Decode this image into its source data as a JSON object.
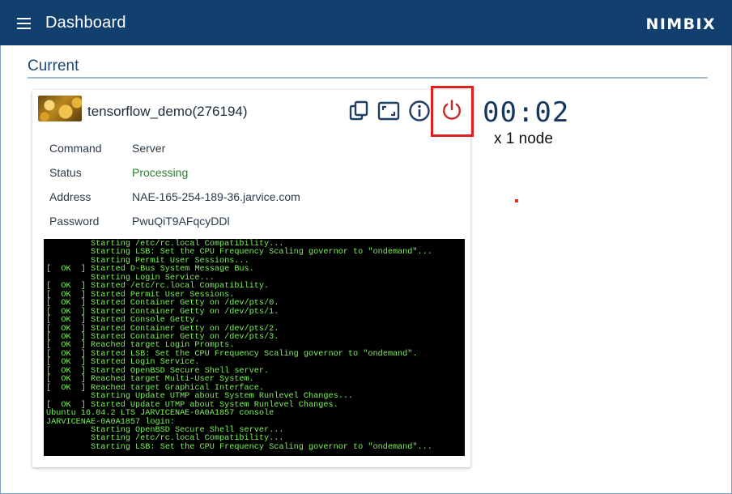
{
  "header": {
    "menu_icon": "hamburger-menu-icon",
    "title": "Dashboard",
    "logo_text": "NIMBIX",
    "background_color": "#113f6e"
  },
  "section": {
    "title": "Current"
  },
  "job": {
    "name": "tensorflow_demo(276194)",
    "thumbnail_icon": "app-thumbnail-image",
    "actions": [
      {
        "name": "copy-icon"
      },
      {
        "name": "fullscreen-icon"
      },
      {
        "name": "info-icon"
      },
      {
        "name": "power-icon",
        "color": "#c62828"
      }
    ],
    "details": [
      {
        "label": "Command",
        "value": "Server"
      },
      {
        "label": "Status",
        "value": "Processing"
      },
      {
        "label": "Address",
        "value": "NAE-165-254-189-36.jarvice.com"
      },
      {
        "label": "Password",
        "value": "PwuQiT9AFqcyDDl"
      }
    ],
    "console_lines": [
      "         Starting /etc/rc.local Compatibility...",
      "         Starting LSB: Set the CPU Frequency Scaling governor to \"ondemand\"...",
      "         Starting Permit User Sessions...",
      "[  OK  ] Started D-Bus System Message Bus.",
      "         Starting Login Service...",
      "[  OK  ] Started /etc/rc.local Compatibility.",
      "[  OK  ] Started Permit User Sessions.",
      "[  OK  ] Started Container Getty on /dev/pts/0.",
      "[  OK  ] Started Container Getty on /dev/pts/1.",
      "[  OK  ] Started Console Getty.",
      "[  OK  ] Started Container Getty on /dev/pts/2.",
      "[  OK  ] Started Container Getty on /dev/pts/3.",
      "[  OK  ] Reached target Login Prompts.",
      "[  OK  ] Started LSB: Set the CPU Frequency Scaling governor to \"ondemand\".",
      "[  OK  ] Started Login Service.",
      "[  OK  ] Started OpenBSD Secure Shell server.",
      "[  OK  ] Reached target Multi-User System.",
      "[  OK  ] Reached target Graphical Interface.",
      "         Starting Update UTMP about System Runlevel Changes...",
      "[  OK  ] Started Update UTMP about System Runlevel Changes.",
      "Ubuntu 16.04.2 LTS JARVICENAE-0A0A1857 console",
      "JARVICENAE-0A0A1857 login:",
      "         Starting OpenBSD Secure Shell server...",
      "         Starting /etc/rc.local Compatibility...",
      "         Starting LSB: Set the CPU Frequency Scaling governor to \"ondemand\"..."
    ]
  },
  "timer": {
    "elapsed": "00:02",
    "nodes_label": "x 1 node"
  },
  "colors": {
    "accent": "#113f6e",
    "status_processing": "#2e7d32",
    "console_text": "#7cf15a",
    "highlight_border": "#e02020"
  }
}
